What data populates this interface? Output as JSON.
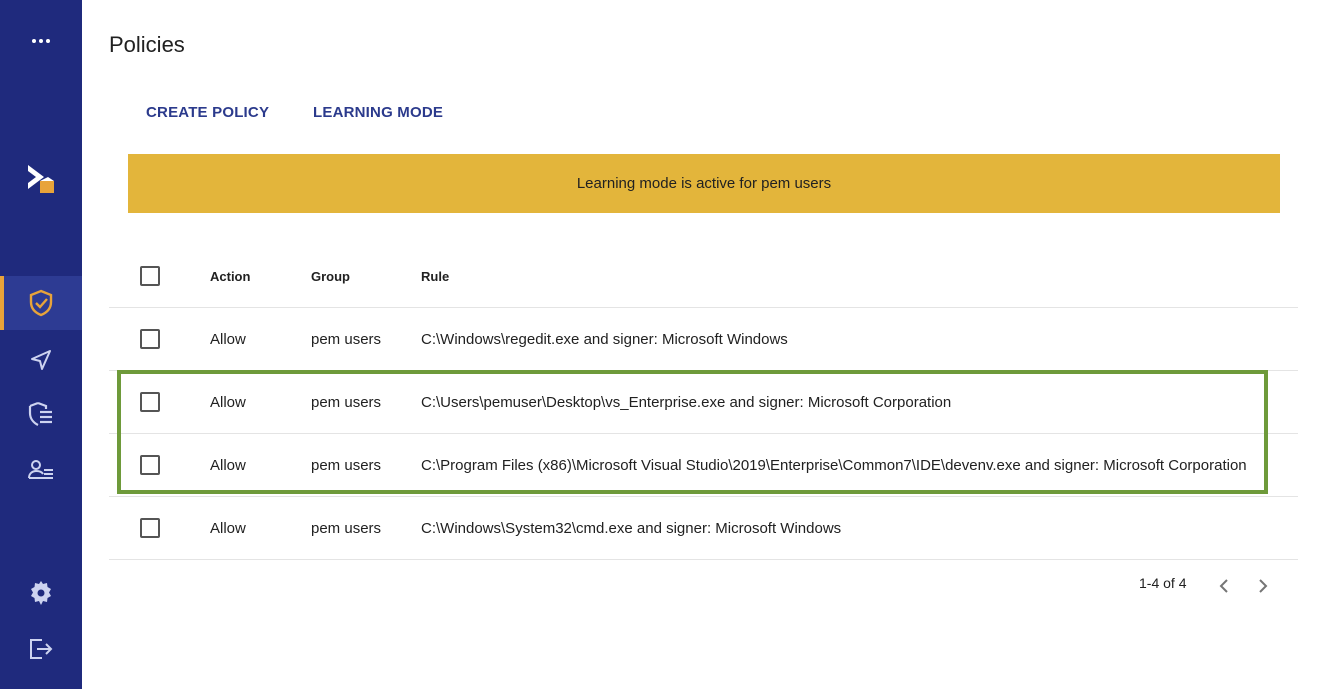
{
  "sidebar": {
    "more_icon": "more-horizontal-icon",
    "logo": "brand-logo",
    "items": [
      {
        "icon": "shield-check-icon",
        "active": true
      },
      {
        "icon": "send-icon",
        "active": false
      },
      {
        "icon": "shield-list-icon",
        "active": false
      },
      {
        "icon": "user-list-icon",
        "active": false
      }
    ],
    "bottom": [
      {
        "icon": "gear-icon"
      },
      {
        "icon": "logout-icon"
      }
    ]
  },
  "page": {
    "title": "Policies"
  },
  "toolbar": {
    "create_label": "CREATE POLICY",
    "learning_label": "LEARNING MODE"
  },
  "banner": {
    "text": "Learning mode is active for pem users",
    "color": "#e3b53b"
  },
  "table": {
    "headers": {
      "action": "Action",
      "group": "Group",
      "rule": "Rule"
    },
    "rows": [
      {
        "action": "Allow",
        "group": "pem users",
        "rule": "C:\\Windows\\regedit.exe and signer: Microsoft Windows"
      },
      {
        "action": "Allow",
        "group": "pem users",
        "rule": "C:\\Users\\pemuser\\Desktop\\vs_Enterprise.exe and signer: Microsoft Corporation"
      },
      {
        "action": "Allow",
        "group": "pem users",
        "rule": "C:\\Program Files (x86)\\Microsoft Visual Studio\\2019\\Enterprise\\Common7\\IDE\\devenv.exe and signer: Microsoft Corporation"
      },
      {
        "action": "Allow",
        "group": "pem users",
        "rule": "C:\\Windows\\System32\\cmd.exe and signer: Microsoft Windows"
      }
    ]
  },
  "pagination": {
    "range": "1-4 of 4"
  },
  "colors": {
    "sidebar": "#1f2a7d",
    "accent": "#e8a33a",
    "link": "#2b3a8c",
    "highlight": "#6e9a3a"
  }
}
